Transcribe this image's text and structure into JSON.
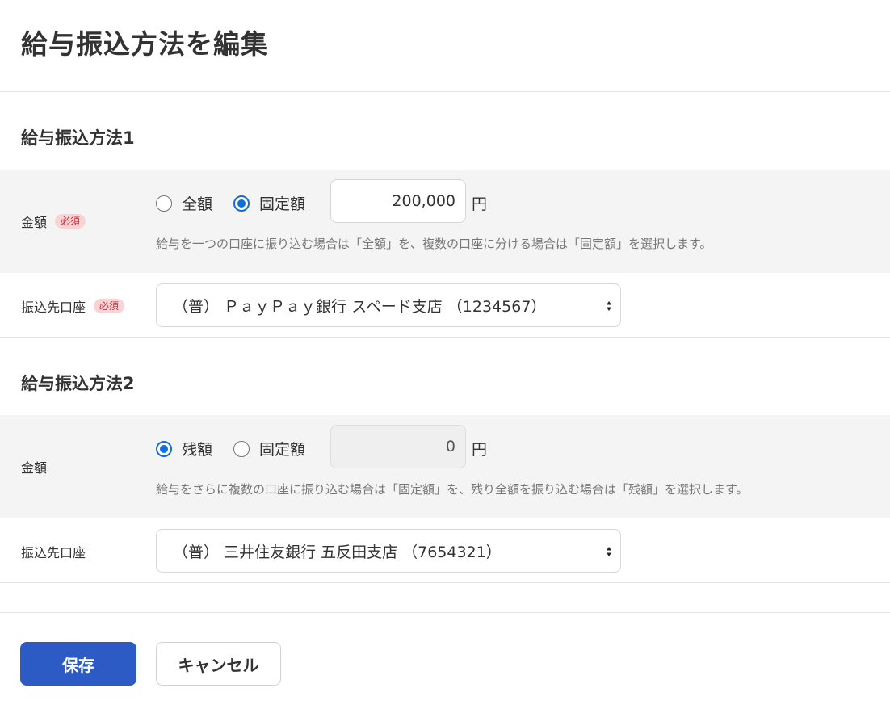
{
  "page": {
    "title": "給与振込方法を編集"
  },
  "methods": [
    {
      "title": "給与振込方法1",
      "amount_label": "金額",
      "amount_badge": "必須",
      "option_a": {
        "label": "全額",
        "checked": false
      },
      "option_b": {
        "label": "固定額",
        "checked": true
      },
      "amount_value": "200,000",
      "unit": "円",
      "help": "給与を一つの口座に振り込む場合は「全額」を、複数の口座に分ける場合は「固定額」を選択します。",
      "account_label": "振込先口座",
      "account_badge": "必須",
      "account_value": "（普） ＰａｙＰａｙ銀行 スペード支店 （1234567）"
    },
    {
      "title": "給与振込方法2",
      "amount_label": "金額",
      "option_a": {
        "label": "残額",
        "checked": true
      },
      "option_b": {
        "label": "固定額",
        "checked": false
      },
      "amount_value": "0",
      "unit": "円",
      "help": "給与をさらに複数の口座に振り込む場合は「固定額」を、残り全額を振り込む場合は「残額」を選択します。",
      "account_label": "振込先口座",
      "account_value": "（普） 三井住友銀行 五反田支店 （7654321）"
    }
  ],
  "buttons": {
    "save": "保存",
    "cancel": "キャンセル"
  },
  "colors": {
    "primary": "#2c5bc6",
    "radio_checked": "#0f6fd8",
    "badge_bg": "#f9d3d6",
    "badge_text": "#c02f3a",
    "shaded_row": "#f5f4f4"
  },
  "icons": {
    "select_arrows": "up-down-arrows-icon"
  }
}
